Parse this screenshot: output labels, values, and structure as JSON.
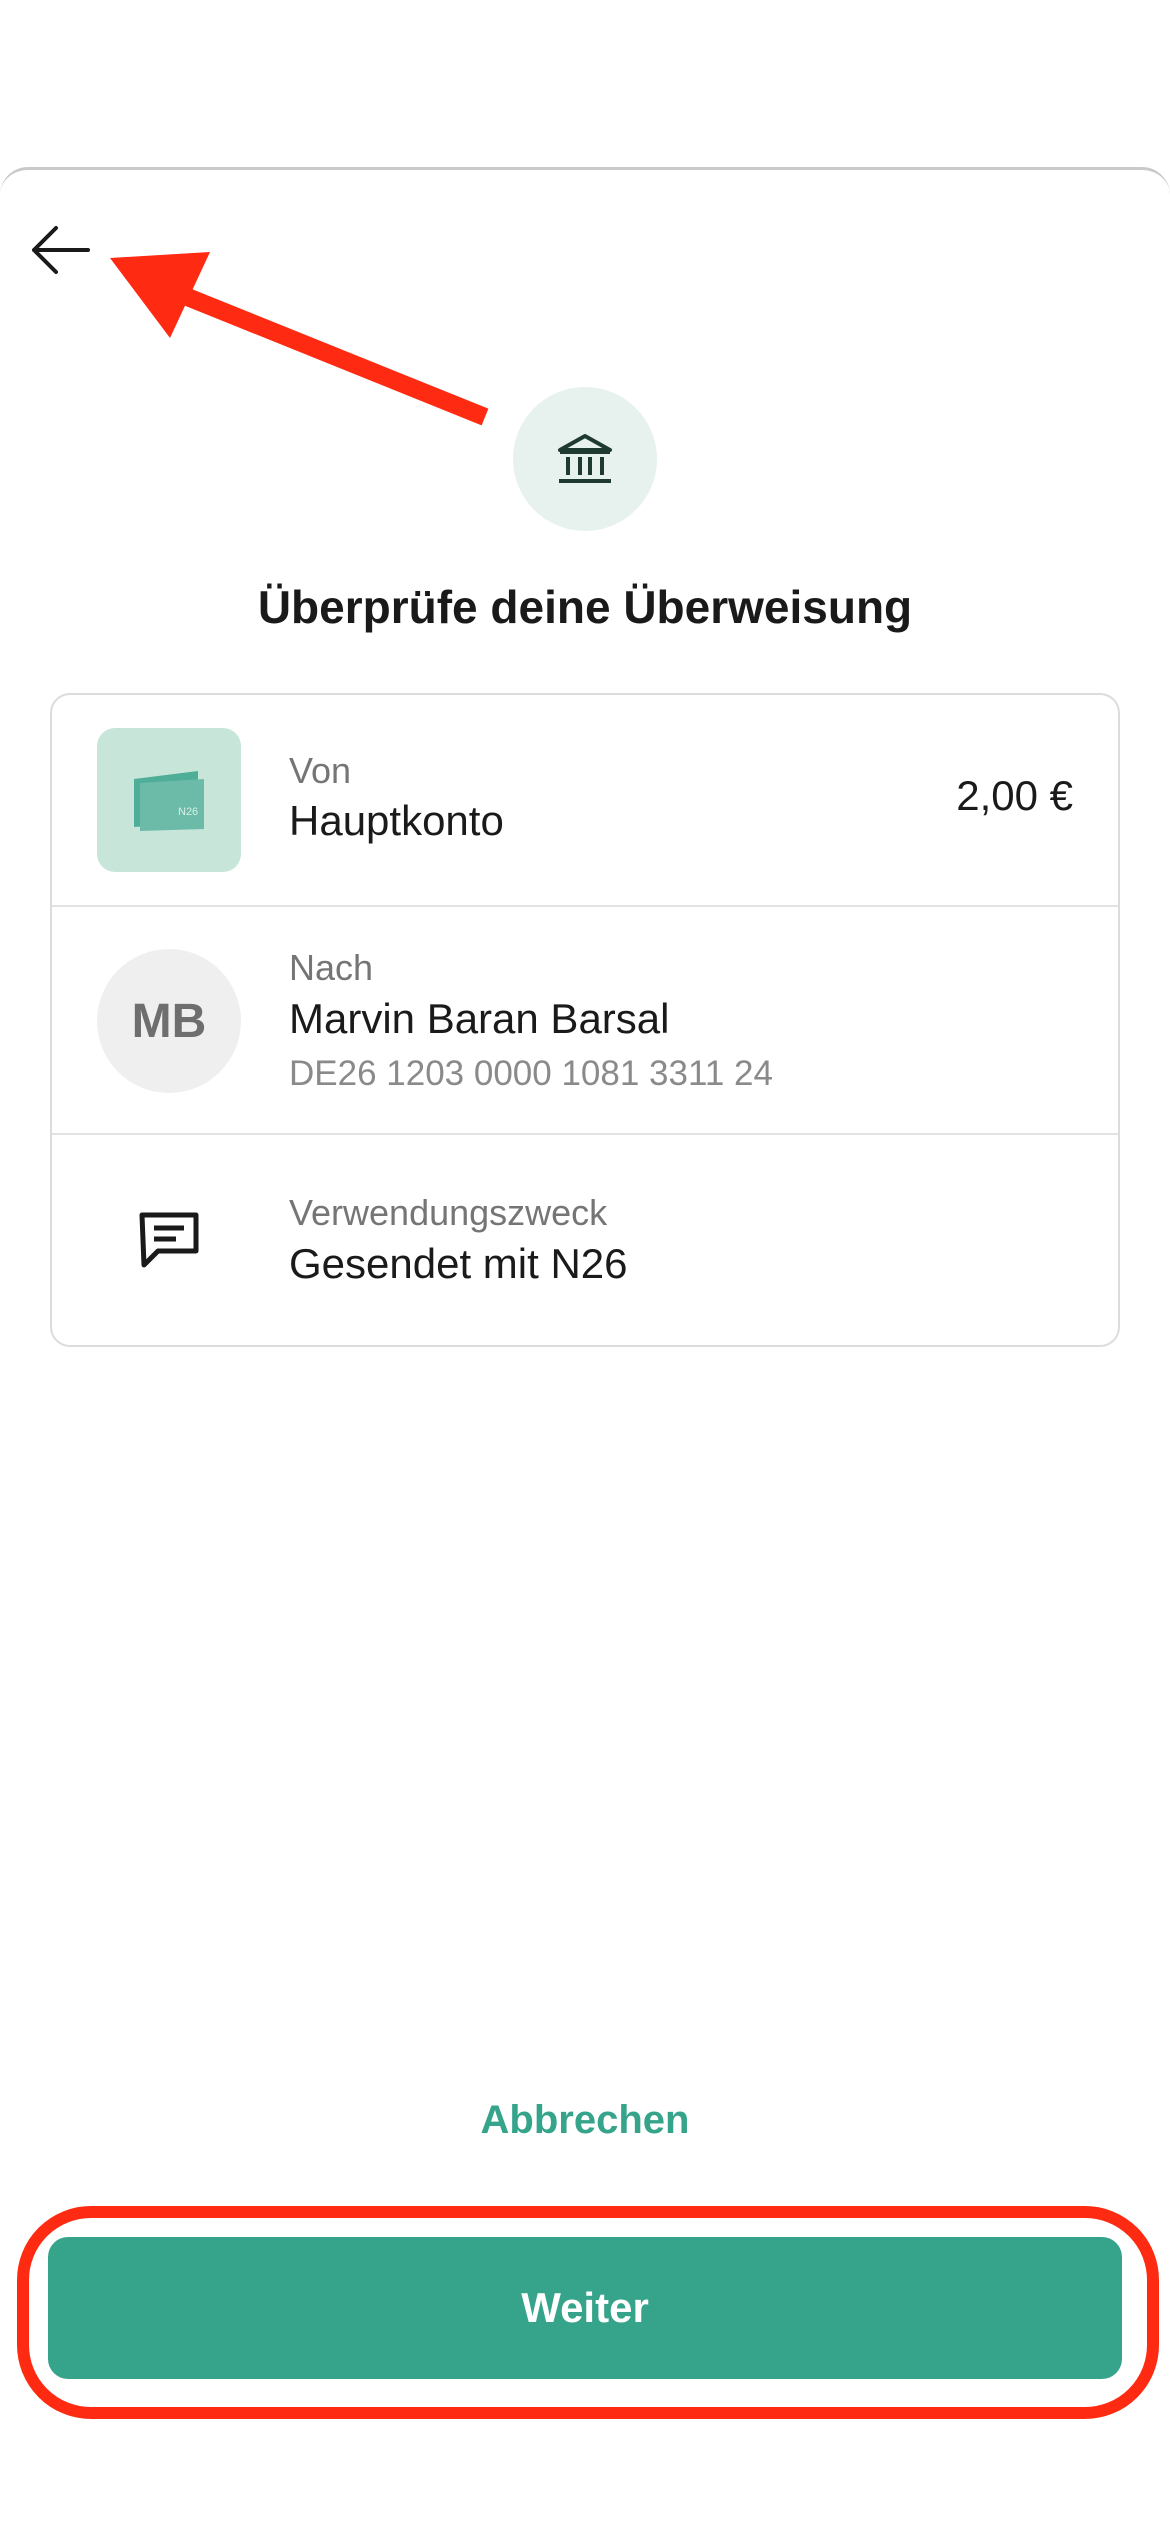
{
  "header": {
    "title": "Überprüfe deine Überweisung"
  },
  "from": {
    "label": "Von",
    "account_name": "Hauptkonto",
    "amount": "2,00 €",
    "card_logo": "N26"
  },
  "to": {
    "label": "Nach",
    "initials": "MB",
    "name": "Marvin Baran Barsal",
    "iban": "DE26 1203 0000 1081 3311 24"
  },
  "reference": {
    "label": "Verwendungszweck",
    "value": "Gesendet mit N26"
  },
  "actions": {
    "cancel_label": "Abbrechen",
    "continue_label": "Weiter"
  },
  "icons": {
    "back": "arrow-left-icon",
    "bank": "bank-icon",
    "message": "message-icon"
  },
  "colors": {
    "accent": "#36a48a",
    "annotation": "#ff2a12",
    "tile": "#c8e5da"
  }
}
